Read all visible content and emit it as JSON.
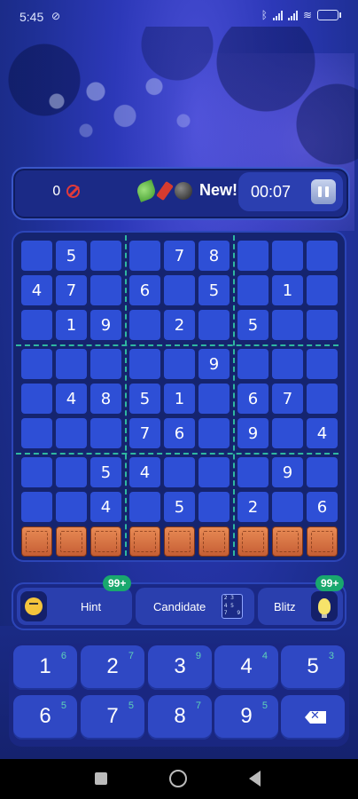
{
  "status_bar": {
    "time": "5:45"
  },
  "top_bar": {
    "mistakes_count": "0",
    "new_label": "New!",
    "timer": "00:07"
  },
  "board": {
    "rows": [
      [
        "",
        "5",
        "",
        "",
        "7",
        "8",
        "",
        "",
        ""
      ],
      [
        "4",
        "7",
        "",
        "6",
        "",
        "5",
        "",
        "1",
        ""
      ],
      [
        "",
        "1",
        "9",
        "",
        "2",
        "",
        "5",
        "",
        ""
      ],
      [
        "",
        "",
        "",
        "",
        "",
        "9",
        "",
        "",
        ""
      ],
      [
        "",
        "4",
        "8",
        "5",
        "1",
        "",
        "6",
        "7",
        ""
      ],
      [
        "",
        "",
        "",
        "7",
        "6",
        "",
        "9",
        "",
        "4"
      ],
      [
        "",
        "",
        "5",
        "4",
        "",
        "",
        "",
        "9",
        ""
      ],
      [
        "",
        "",
        "4",
        "",
        "5",
        "",
        "2",
        "",
        "6"
      ],
      [
        "",
        "",
        "",
        "",
        "",
        "",
        "",
        "",
        ""
      ]
    ],
    "special_cells": {
      "bomb": [
        6,
        6
      ],
      "spider": [
        7,
        3
      ]
    },
    "crate_row": 8
  },
  "actions": {
    "hint_label": "Hint",
    "hint_badge": "99+",
    "candidate_label": "Candidate",
    "candidate_icon_digits": [
      "2",
      "3",
      "",
      "4",
      "5",
      "",
      "7",
      "",
      "9"
    ],
    "blitz_label": "Blitz",
    "blitz_badge": "99+"
  },
  "numpad": {
    "keys": [
      {
        "digit": "1",
        "count": "6"
      },
      {
        "digit": "2",
        "count": "7"
      },
      {
        "digit": "3",
        "count": "9"
      },
      {
        "digit": "4",
        "count": "4"
      },
      {
        "digit": "5",
        "count": "3"
      },
      {
        "digit": "6",
        "count": "5"
      },
      {
        "digit": "7",
        "count": "5"
      },
      {
        "digit": "8",
        "count": "7"
      },
      {
        "digit": "9",
        "count": "5"
      }
    ]
  },
  "colors": {
    "cell": "#2e4fd6",
    "box_divider": "#2fb7a0",
    "badge": "#19a86e"
  },
  "icons": {
    "mistakes": "no-entry-icon",
    "new_powers": [
      "leaf-icon",
      "dynamite-icon",
      "bomb-icon"
    ],
    "pause": "pause-icon",
    "hint": "thinking-face-icon",
    "candidate": "candidate-grid-icon",
    "blitz": "lightbulb-icon",
    "erase": "backspace-icon"
  }
}
